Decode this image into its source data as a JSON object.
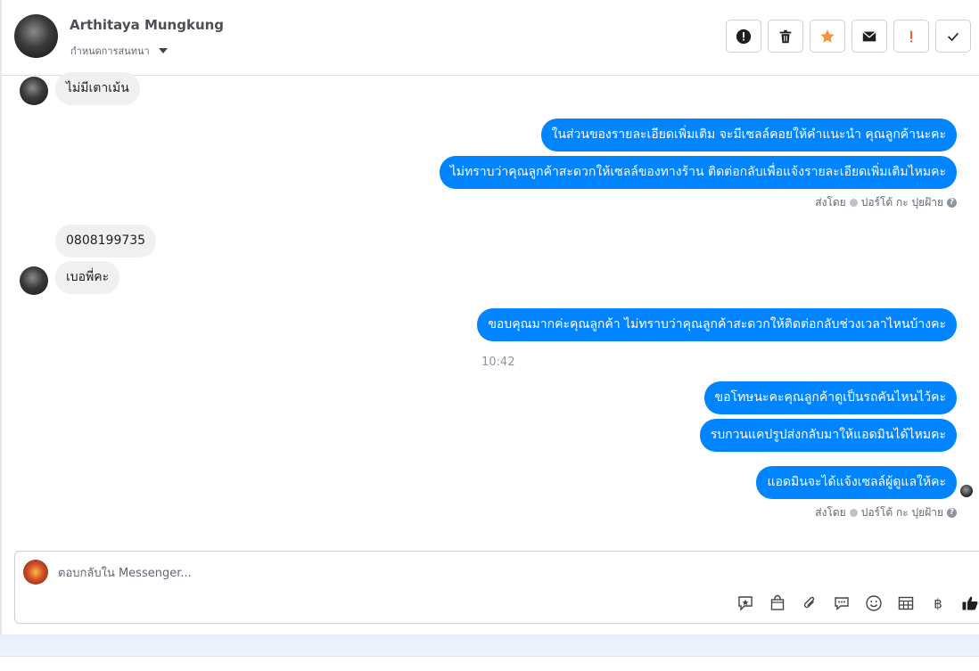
{
  "header": {
    "contact_name": "Arthitaya Mungkung",
    "subtitle": "กำหนดการสนทนา",
    "tools": [
      {
        "icon": "alert-circle-icon",
        "name": "mark-spam-button"
      },
      {
        "icon": "trash-icon",
        "name": "delete-button"
      },
      {
        "icon": "star-icon",
        "name": "star-button",
        "color": "#f7923b"
      },
      {
        "icon": "envelope-icon",
        "name": "mark-unread-button"
      },
      {
        "icon": "exclamation-icon",
        "name": "follow-up-button",
        "color": "#e4572e"
      },
      {
        "icon": "check-icon",
        "name": "mark-done-button"
      }
    ]
  },
  "messages": {
    "m1": "ไม่มีเตาเม้น",
    "m2": "ในส่วนของรายละเอียดเพิ่มเติม จะมีเซลล์คอยให้คำแนะนำ คุณลูกค้านะคะ",
    "m3": "ไม่ทราบว่าคุณลูกค้าสะดวกให้เซลล์ของทางร้าน ติดต่อกลับเพื่อแจ้งรายละเอียดเพิ่มเติมไหมคะ",
    "meta1": "ส่งโดย",
    "meta1_sender": "ปอร์โต้ กะ ปุยฝ้าย",
    "m4": "0808199735",
    "m5": "เบอพี่คะ",
    "m6": "ขอบคุณมากค่ะคุณลูกค้า ไม่ทราบว่าคุณลูกค้าสะดวกให้ติดต่อกลับช่วงเวลาไหนบ้างคะ",
    "time": "10:42",
    "m7": "ขอโทษนะคะคุณลูกค้าดูเป็นรถคันไหนไว้คะ",
    "m8": "รบกวนแคปรูปส่งกลับมาให้แอดมินได้ไหมคะ",
    "m9": "แอดมินจะได้แจ้งเซลล์ผู้ดูแลให้คะ",
    "meta2": "ส่งโดย",
    "meta2_sender": "ปอร์โต้ กะ ปุยฝ้าย"
  },
  "composer": {
    "placeholder": "ตอบกลับใน Messenger...",
    "tools": [
      "saved-reply-icon",
      "shopping-bag-icon",
      "paperclip-icon",
      "chat-bubble-icon",
      "smiley-icon",
      "table-icon",
      "baht-icon",
      "thumbs-up-icon"
    ]
  },
  "colors": {
    "outgoing_bubble": "#0084ff",
    "incoming_bubble": "#f0f0f0",
    "star": "#f7923b",
    "flag": "#e4572e"
  }
}
